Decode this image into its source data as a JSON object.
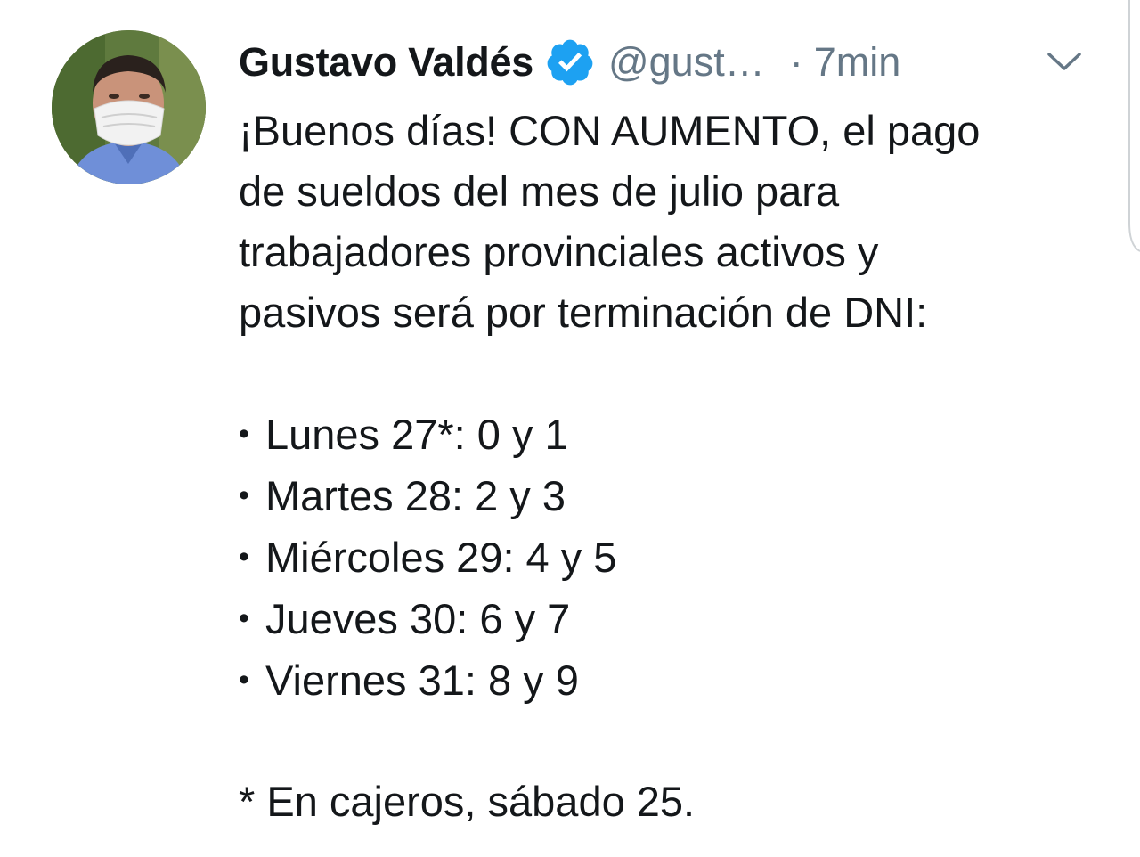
{
  "tweet": {
    "author_name": "Gustavo Valdés",
    "handle": "@gust…",
    "separator": "·",
    "timestamp": "7min",
    "text_lines": [
      "¡Buenos días! CON AUMENTO, el pago",
      "de sueldos del mes de julio para",
      "trabajadores provinciales activos y",
      "pasivos será por terminación de DNI:"
    ],
    "bullet_glyph": "•",
    "schedule": [
      "Lunes 27*: 0 y 1",
      "Martes 28: 2 y 3",
      "Miércoles 29: 4 y 5",
      "Jueves 30: 6 y 7",
      "Viernes 31: 8 y 9"
    ],
    "footnote": "* En cajeros, sábado 25."
  },
  "icons": {
    "verified": "verified-badge-icon",
    "menu": "chevron-down-icon"
  },
  "colors": {
    "text": "#14171a",
    "secondary": "#657786",
    "verified_blue": "#1da1f2"
  }
}
